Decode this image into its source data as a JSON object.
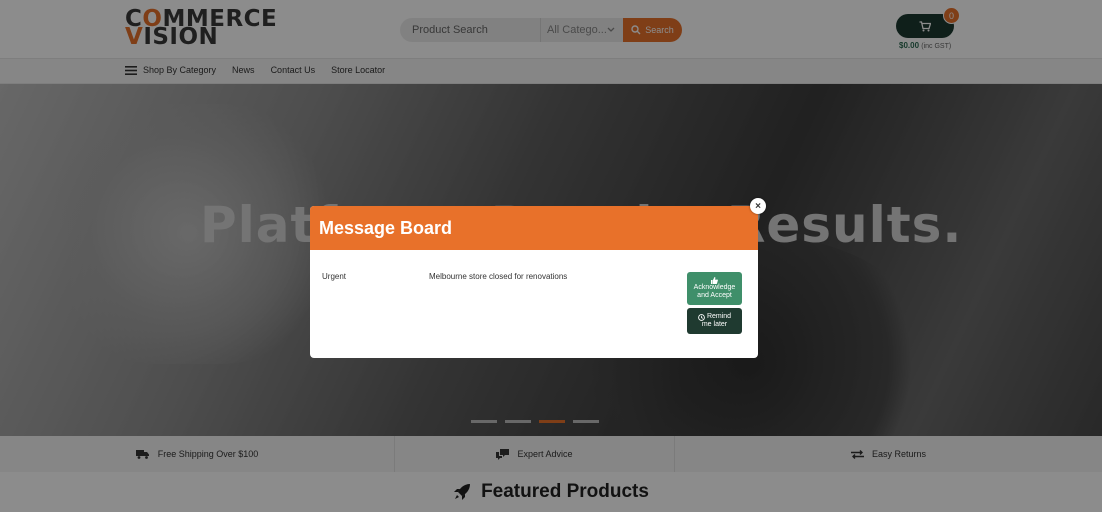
{
  "header": {
    "logo_line1_pre": "C",
    "logo_line1_o": "O",
    "logo_line1_post": "MMERCE",
    "logo_line2_v": "V",
    "logo_line2_post": "ISION",
    "search": {
      "placeholder": "Product Search",
      "category_label": "All Catego...",
      "button_label": "Search"
    },
    "cart": {
      "count": "0",
      "total": "$0.00",
      "gst_note": "(inc GST)"
    }
  },
  "nav": {
    "items": [
      {
        "label": "Shop By Category",
        "icon": "hamburger-icon"
      },
      {
        "label": "News"
      },
      {
        "label": "Contact Us"
      },
      {
        "label": "Store Locator"
      }
    ]
  },
  "hero": {
    "headline": "Platform. People. Results.",
    "slide_count": 4,
    "active_slide": 3
  },
  "features": [
    {
      "label": "Free Shipping Over $100",
      "icon": "truck-icon"
    },
    {
      "label": "Expert Advice",
      "icon": "comments-icon"
    },
    {
      "label": "Easy Returns",
      "icon": "exchange-icon"
    }
  ],
  "featured": {
    "title": "Featured Products",
    "icon": "rocket-icon"
  },
  "modal": {
    "title": "Message Board",
    "close_label": "×",
    "message": {
      "priority": "Urgent",
      "text": "Melbourne store closed for renovations"
    },
    "accept_line1": "Acknowledge",
    "accept_line2": "and Accept",
    "remind_line1": "Remind",
    "remind_line2": "me later"
  },
  "colors": {
    "accent": "#e8712a",
    "dark_green": "#1c3a30",
    "green": "#3f8f6a"
  }
}
